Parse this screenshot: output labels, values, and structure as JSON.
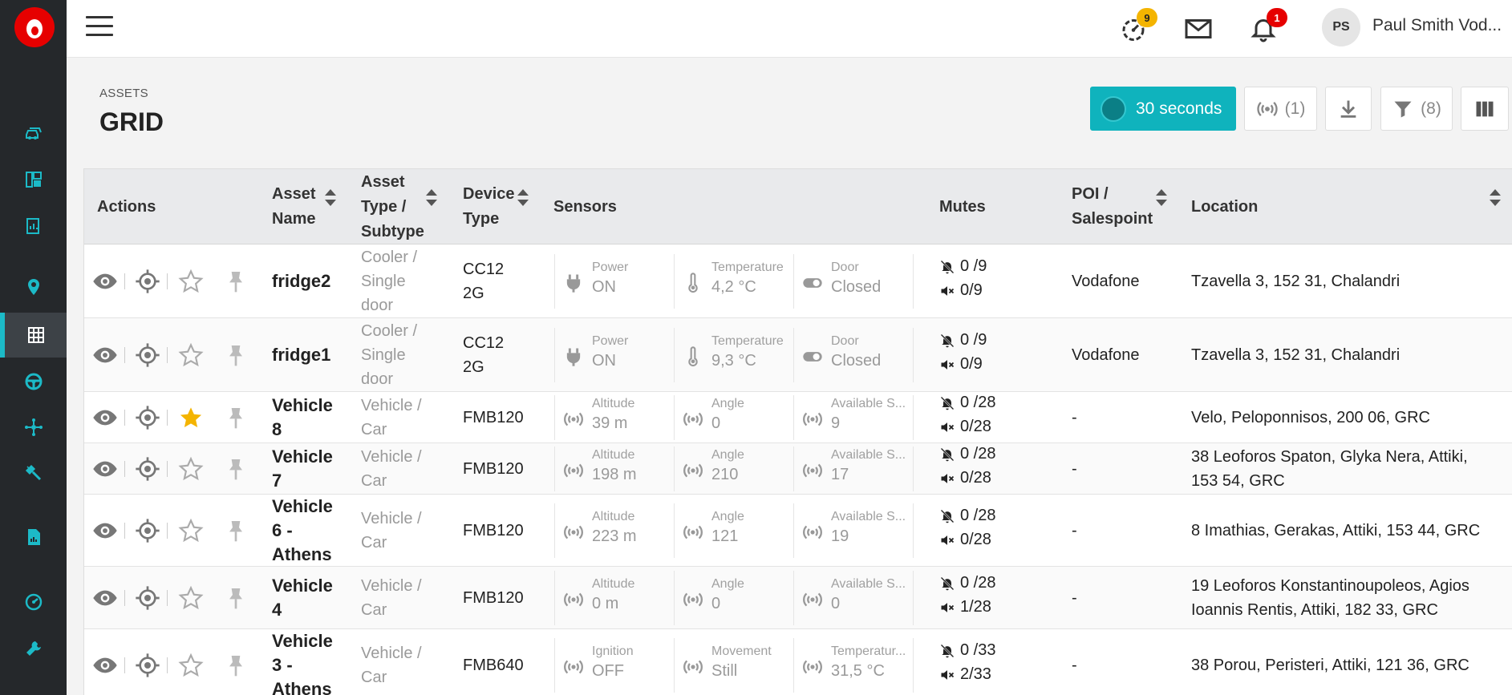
{
  "colors": {
    "sidebar_bg": "#25282b",
    "accent": "#1cbac7",
    "brand_red": "#e60000",
    "refresh_btn": "#0fb3bd",
    "star_active": "#f4b400"
  },
  "sidebar": {
    "logo": "vodafone-logo",
    "items": [
      {
        "icon": "vehicle-fleet-icon"
      },
      {
        "icon": "dashboard-icon"
      },
      {
        "icon": "reports-icon"
      },
      {
        "icon": "map-pin-icon"
      },
      {
        "icon": "grid-icon",
        "active": true
      },
      {
        "icon": "steering-wheel-icon"
      },
      {
        "icon": "network-icon"
      },
      {
        "icon": "tools-icon"
      },
      {
        "icon": "document-chart-icon"
      },
      {
        "icon": "gauge-icon"
      },
      {
        "icon": "wrench-icon"
      }
    ]
  },
  "topbar": {
    "tasks_badge": "9",
    "notifications_badge": "1",
    "avatar_initials": "PS",
    "user_name": "Paul Smith Vod..."
  },
  "page": {
    "breadcrumb": "ASSETS",
    "title": "GRID"
  },
  "toolbar": {
    "refresh_label": "30 seconds",
    "live_label": "(1)",
    "filter_label": "(8)"
  },
  "table": {
    "headers": {
      "actions": "Actions",
      "asset_name_1": "Asset",
      "asset_name_2": "Name",
      "asset_type_1": "Asset",
      "asset_type_2": "Type /",
      "asset_type_3": "Subtype",
      "device_type_1": "Device",
      "device_type_2": "Type",
      "sensors": "Sensors",
      "mutes": "Mutes",
      "poi_1": "POI /",
      "poi_2": "Salespoint",
      "location": "Location"
    },
    "rows": [
      {
        "starred": false,
        "name": [
          "fridge2"
        ],
        "type": [
          "Cooler /",
          "Single",
          "door"
        ],
        "device": [
          "CC12",
          "2G"
        ],
        "sensors": [
          {
            "icon": "plug-icon",
            "label": "Power",
            "value": "ON"
          },
          {
            "icon": "thermometer-icon",
            "label": "Temperature",
            "value": "4,2 °C"
          },
          {
            "icon": "toggle-icon",
            "label": "Door",
            "value": "Closed"
          }
        ],
        "mute_notif": "0 /9",
        "mute_sound": "0/9",
        "poi": "Vodafone",
        "location": [
          "Tzavella 3, 152 31, Chalandri"
        ]
      },
      {
        "starred": false,
        "name": [
          "fridge1"
        ],
        "type": [
          "Cooler /",
          "Single",
          "door"
        ],
        "device": [
          "CC12",
          "2G"
        ],
        "sensors": [
          {
            "icon": "plug-icon",
            "label": "Power",
            "value": "ON"
          },
          {
            "icon": "thermometer-icon",
            "label": "Temperature",
            "value": "9,3 °C"
          },
          {
            "icon": "toggle-icon",
            "label": "Door",
            "value": "Closed"
          }
        ],
        "mute_notif": "0 /9",
        "mute_sound": "0/9",
        "poi": "Vodafone",
        "location": [
          "Tzavella 3, 152 31, Chalandri"
        ]
      },
      {
        "starred": true,
        "name": [
          "Vehicle",
          "8"
        ],
        "type": [
          "Vehicle /",
          "Car"
        ],
        "device": [
          "FMB120"
        ],
        "sensors": [
          {
            "icon": "signal-icon",
            "label": "Altitude",
            "value": "39 m"
          },
          {
            "icon": "signal-icon",
            "label": "Angle",
            "value": "0"
          },
          {
            "icon": "signal-icon",
            "label": "Available S...",
            "value": "9"
          }
        ],
        "mute_notif": "0 /28",
        "mute_sound": "0/28",
        "poi": "-",
        "location": [
          "Velo, Peloponnisos, 200 06, GRC"
        ]
      },
      {
        "starred": false,
        "name": [
          "Vehicle",
          "7"
        ],
        "type": [
          "Vehicle /",
          "Car"
        ],
        "device": [
          "FMB120"
        ],
        "sensors": [
          {
            "icon": "signal-icon",
            "label": "Altitude",
            "value": "198 m"
          },
          {
            "icon": "signal-icon",
            "label": "Angle",
            "value": "210"
          },
          {
            "icon": "signal-icon",
            "label": "Available S...",
            "value": "17"
          }
        ],
        "mute_notif": "0 /28",
        "mute_sound": "0/28",
        "poi": "-",
        "location": [
          "38 Leoforos Spaton, Glyka Nera, Attiki,",
          "153 54, GRC"
        ]
      },
      {
        "starred": false,
        "name": [
          "Vehicle",
          "6 -",
          "Athens"
        ],
        "type": [
          "Vehicle /",
          "Car"
        ],
        "device": [
          "FMB120"
        ],
        "sensors": [
          {
            "icon": "signal-icon",
            "label": "Altitude",
            "value": "223 m"
          },
          {
            "icon": "signal-icon",
            "label": "Angle",
            "value": "121"
          },
          {
            "icon": "signal-icon",
            "label": "Available S...",
            "value": "19"
          }
        ],
        "mute_notif": "0 /28",
        "mute_sound": "0/28",
        "poi": "-",
        "location": [
          "8 Imathias, Gerakas, Attiki, 153 44, GRC"
        ]
      },
      {
        "starred": false,
        "name": [
          "Vehicle",
          "4"
        ],
        "type": [
          "Vehicle /",
          "Car"
        ],
        "device": [
          "FMB120"
        ],
        "sensors": [
          {
            "icon": "signal-icon",
            "label": "Altitude",
            "value": "0 m"
          },
          {
            "icon": "signal-icon",
            "label": "Angle",
            "value": "0"
          },
          {
            "icon": "signal-icon",
            "label": "Available S...",
            "value": "0"
          }
        ],
        "mute_notif": "0 /28",
        "mute_sound": "1/28",
        "poi": "-",
        "location": [
          "19 Leoforos Konstantinoupoleos, Agios",
          "Ioannis Rentis, Attiki, 182 33, GRC"
        ]
      },
      {
        "starred": false,
        "name": [
          "Vehicle",
          "3 -",
          "Athens"
        ],
        "type": [
          "Vehicle /",
          "Car"
        ],
        "device": [
          "FMB640"
        ],
        "sensors": [
          {
            "icon": "signal-icon",
            "label": "Ignition",
            "value": "OFF"
          },
          {
            "icon": "signal-icon",
            "label": "Movement",
            "value": "Still"
          },
          {
            "icon": "signal-icon",
            "label": "Temperatur...",
            "value": "31,5 °C"
          }
        ],
        "mute_notif": "0 /33",
        "mute_sound": "2/33",
        "poi": "-",
        "location": [
          "38 Porou, Peristeri, Attiki, 121 36, GRC"
        ]
      }
    ]
  }
}
